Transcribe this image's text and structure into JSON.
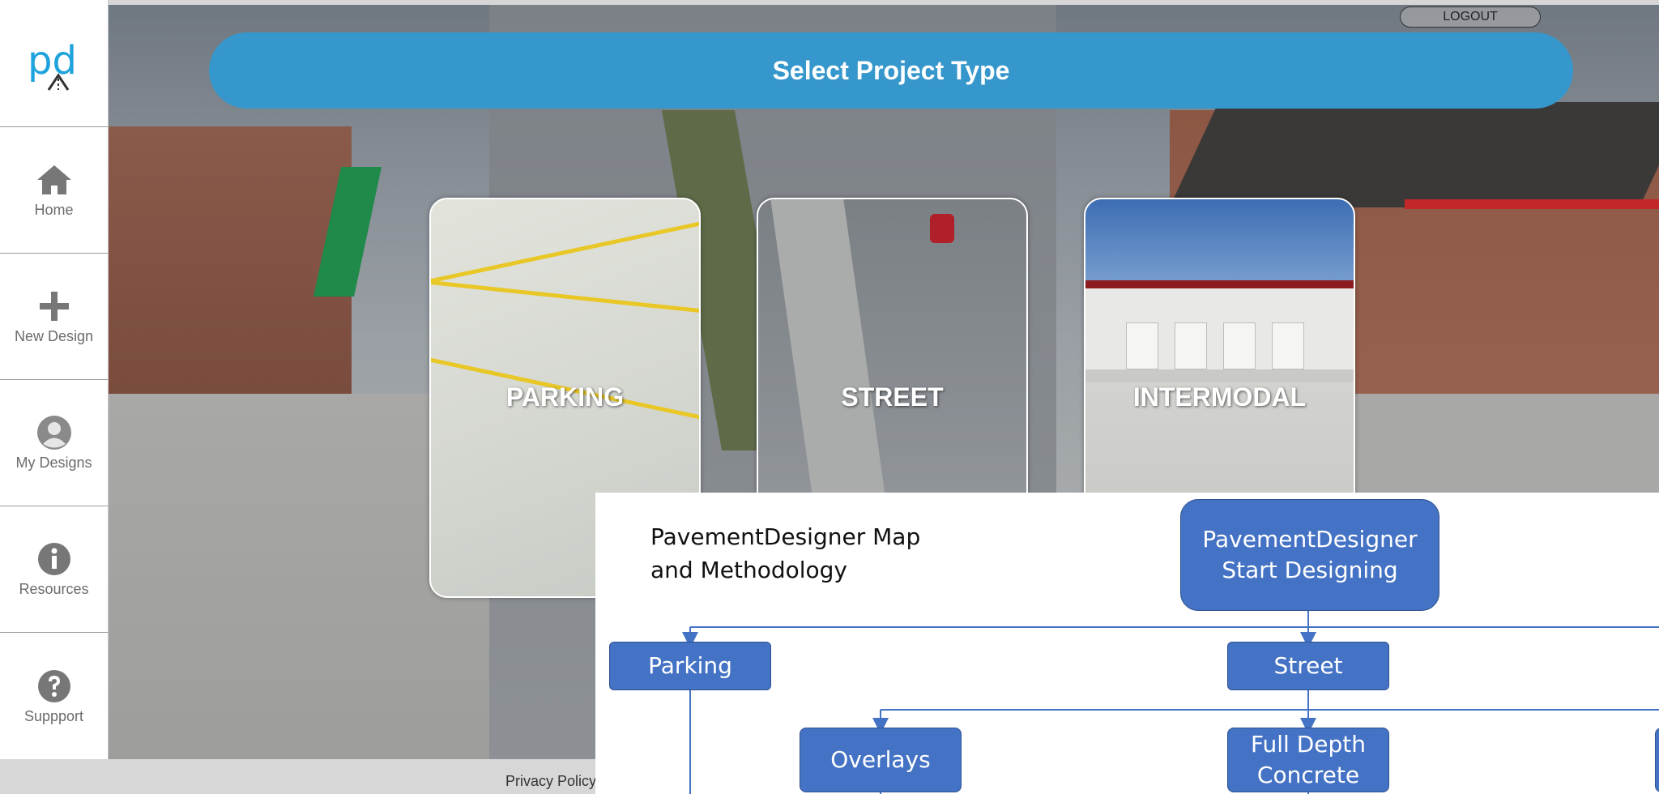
{
  "app": {
    "logo_text": "pd"
  },
  "sidebar": {
    "items": [
      {
        "label": "Home",
        "icon": "home-icon"
      },
      {
        "label": "New Design",
        "icon": "plus-icon"
      },
      {
        "label": "My Designs",
        "icon": "user-icon"
      },
      {
        "label": "Resources",
        "icon": "info-icon"
      },
      {
        "label": "Suppport",
        "icon": "question-icon"
      }
    ]
  },
  "header": {
    "title": "Select Project Type",
    "logout_label": "LOGOUT"
  },
  "cards": [
    {
      "label": "PARKING"
    },
    {
      "label": "STREET"
    },
    {
      "label": "INTERMODAL"
    }
  ],
  "footer": {
    "privacy_label": "Privacy Policy"
  },
  "flowchart": {
    "title_line1": "PavementDesigner Map",
    "title_line2": "and Methodology",
    "start_line1": "PavementDesigner",
    "start_line2": "Start Designing",
    "parking": "Parking",
    "street": "Street",
    "overlays": "Overlays",
    "full_depth_line1": "Full Depth",
    "full_depth_line2": "Concrete"
  },
  "colors": {
    "header_blue": "#3597cb",
    "flow_box": "#4472c4",
    "sidebar_icon": "#777777"
  }
}
